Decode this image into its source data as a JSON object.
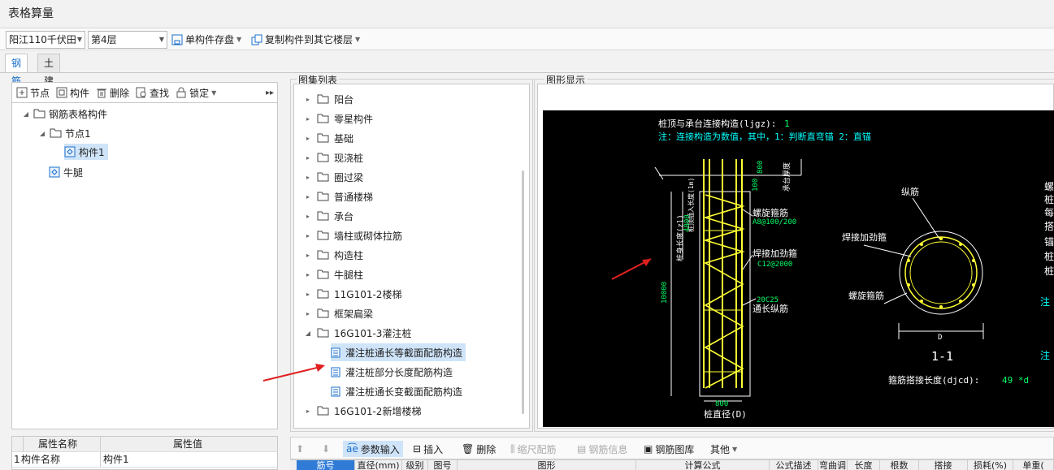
{
  "window": {
    "title": "表格算量"
  },
  "toolbar": {
    "project": "阳江110千伏田",
    "floor": "第4层",
    "save_single": "单构件存盘",
    "copy_to_floor": "复制构件到其它楼层"
  },
  "tabs": [
    "钢筋",
    "土建"
  ],
  "left_toolbar": {
    "node": "节点",
    "component": "构件",
    "delete": "删除",
    "find": "查找",
    "lock": "锁定"
  },
  "tree": {
    "root": "钢筋表格构件",
    "node1": "节点1",
    "comp1": "构件1",
    "corbel": "牛腿"
  },
  "props": {
    "col_name": "属性名称",
    "col_value": "属性值",
    "rows": [
      {
        "idx": "1",
        "name": "构件名称",
        "value": "构件1"
      }
    ]
  },
  "atlas": {
    "label": "图集列表",
    "folders": [
      "阳台",
      "零星构件",
      "基础",
      "现浇桩",
      "圈过梁",
      "普通楼梯",
      "承台",
      "墙柱或砌体拉筋",
      "构造柱",
      "牛腿柱",
      "11G101-2楼梯",
      "框架扁梁",
      "16G101-3灌注桩"
    ],
    "children": [
      "灌注桩通长等截面配筋构造",
      "灌注桩部分长度配筋构造",
      "灌注桩通长变截面配筋构造"
    ],
    "last_folder": "16G101-2新增楼梯"
  },
  "graphic": {
    "label": "图形显示",
    "top_line": "桩顶与承台连接构造(ljgz):",
    "top_value": "1",
    "note_line": "注：连接构造为数值，其中，1：判断直弯锚      2：直锚",
    "dim_800_top": "800",
    "cap_thickness": "承台厚度",
    "anchor_len": "桩顶插入长度(1m)",
    "dim_100": "100",
    "dim_4000": "4000",
    "spiral_label": "螺旋箍筋",
    "spiral_value": "A8@100/200",
    "weld_label": "焊接加劲箍",
    "weld_value": "C12@2000",
    "main_value": "20C25",
    "main_label": "通长纵筋",
    "dim_10000": "10000",
    "pile_len": "桩身长度(zl)",
    "dim_800": "800",
    "pile_dia": "桩直径(D)",
    "sec_long": "纵筋",
    "sec_weld": "焊接加劲箍",
    "sec_spiral": "螺旋箍筋",
    "sec_d": "D",
    "sec_name": "1-1",
    "overlap_label": "箍筋搭接长度(djcd):",
    "overlap_value": "49 *d",
    "right_edge_chars": [
      "螺",
      "桩",
      "每",
      "搭",
      "锚",
      "桩",
      "桩",
      "注",
      "注"
    ]
  },
  "bottom_toolbar": {
    "param_input": "参数输入",
    "insert": "插入",
    "delete": "删除",
    "scale": "缩尺配筋",
    "info": "钢筋信息",
    "library": "钢筋图库",
    "other": "其他"
  },
  "table_headers": [
    "筋号",
    "直径(mm)",
    "级别",
    "图号",
    "图形",
    "计算公式",
    "公式描述",
    "弯曲调",
    "长度",
    "根数",
    "搭接",
    "损耗(%)",
    "单重("
  ]
}
